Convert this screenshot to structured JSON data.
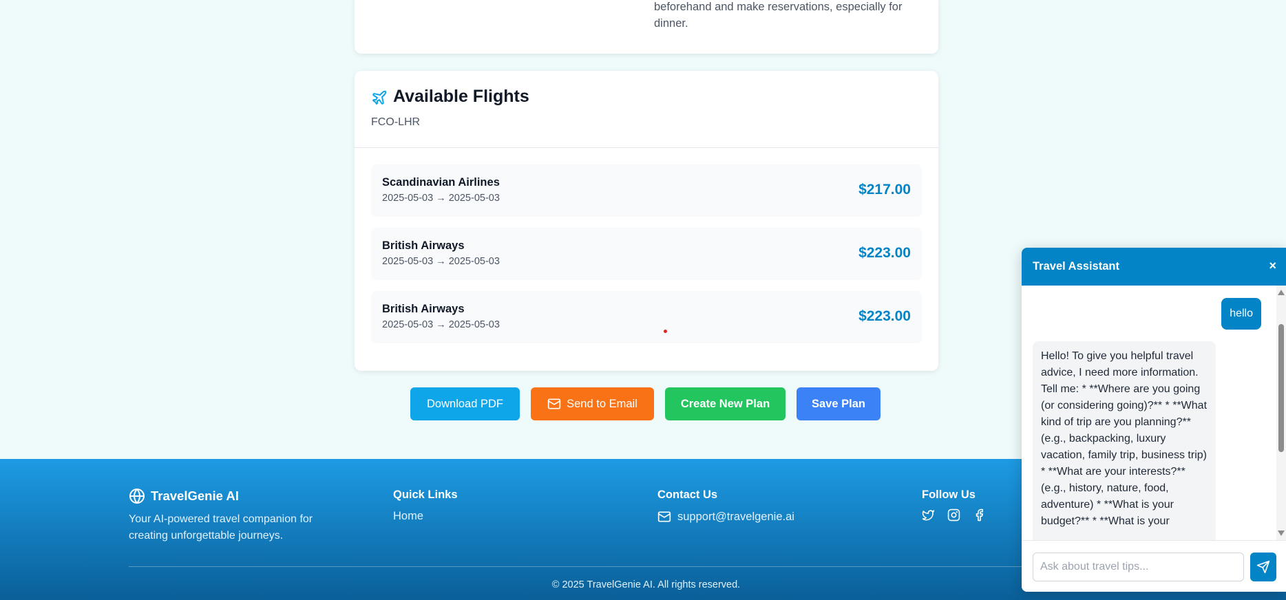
{
  "top_card": {
    "tip_text": "beforehand and make reservations, especially for dinner."
  },
  "flights": {
    "icon": "plane-icon",
    "title": "Available Flights",
    "route": "FCO-LHR",
    "items": [
      {
        "airline": "Scandinavian Airlines",
        "dates": "2025-05-03 → 2025-05-03",
        "price": "$217.00"
      },
      {
        "airline": "British Airways",
        "dates": "2025-05-03 → 2025-05-03",
        "price": "$223.00"
      },
      {
        "airline": "British Airways",
        "dates": "2025-05-03 → 2025-05-03",
        "price": "$223.00"
      }
    ]
  },
  "actions": {
    "download_pdf": "Download PDF",
    "send_email": "Send to Email",
    "create_plan": "Create New Plan",
    "save_plan": "Save Plan"
  },
  "footer": {
    "brand": "TravelGenie AI",
    "tagline": "Your AI-powered travel companion for creating unforgettable journeys.",
    "quick_links_title": "Quick Links",
    "home_link": "Home",
    "contact_title": "Contact Us",
    "email": "support@travelgenie.ai",
    "follow_title": "Follow Us",
    "copyright": "© 2025 TravelGenie AI. All rights reserved."
  },
  "chat": {
    "title": "Travel Assistant",
    "close_label": "×",
    "user_message": "hello",
    "bot_message": "Hello! To give you helpful travel advice, I need more information. Tell me: * **Where are you going (or considering going)?** * **What kind of trip are you planning?** (e.g., backpacking, luxury vacation, family trip, business trip) * **What are your interests?** (e.g., history, nature, food, adventure) * **What is your budget?** * **What is your",
    "input_placeholder": "Ask about travel tips..."
  },
  "colors": {
    "accent": "#0284c7",
    "pdf_button": "#0ea5e9",
    "email_button": "#f97316",
    "create_button": "#22c55e",
    "save_button": "#3b82f6"
  }
}
